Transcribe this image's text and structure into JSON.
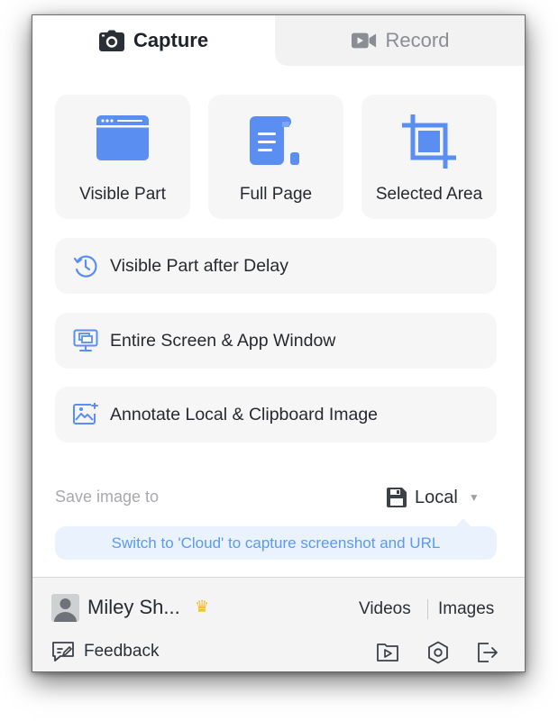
{
  "tabs": [
    {
      "label": "Capture",
      "icon": "camera-icon",
      "active": true
    },
    {
      "label": "Record",
      "icon": "video-camera-icon",
      "active": false
    }
  ],
  "tiles": [
    {
      "label": "Visible Part",
      "icon": "browser-window-icon"
    },
    {
      "label": "Full Page",
      "icon": "scroll-page-icon"
    },
    {
      "label": "Selected Area",
      "icon": "crop-icon"
    }
  ],
  "rows": [
    {
      "label": "Visible Part after Delay",
      "icon": "clock-delay-icon"
    },
    {
      "label": "Entire Screen & App Window",
      "icon": "monitor-windows-icon"
    },
    {
      "label": "Annotate Local & Clipboard Image",
      "icon": "image-annotate-icon"
    }
  ],
  "save": {
    "label": "Save image to",
    "value": "Local",
    "icon": "floppy-disk-icon",
    "hint": "Switch to 'Cloud' to capture screenshot and URL"
  },
  "footer": {
    "user_name": "Miley Sh...",
    "crown": "♛",
    "videos_label": "Videos",
    "images_label": "Images",
    "feedback_label": "Feedback",
    "icons": [
      "video-folder-icon",
      "settings-hexagon-icon",
      "logout-icon"
    ]
  },
  "colors": {
    "accent": "#5a8ef0",
    "tile_bg": "#f6f6f7",
    "hint_bg": "#eaf2fd",
    "hint_text": "#5a9af0",
    "crown": "#f5b81c"
  }
}
